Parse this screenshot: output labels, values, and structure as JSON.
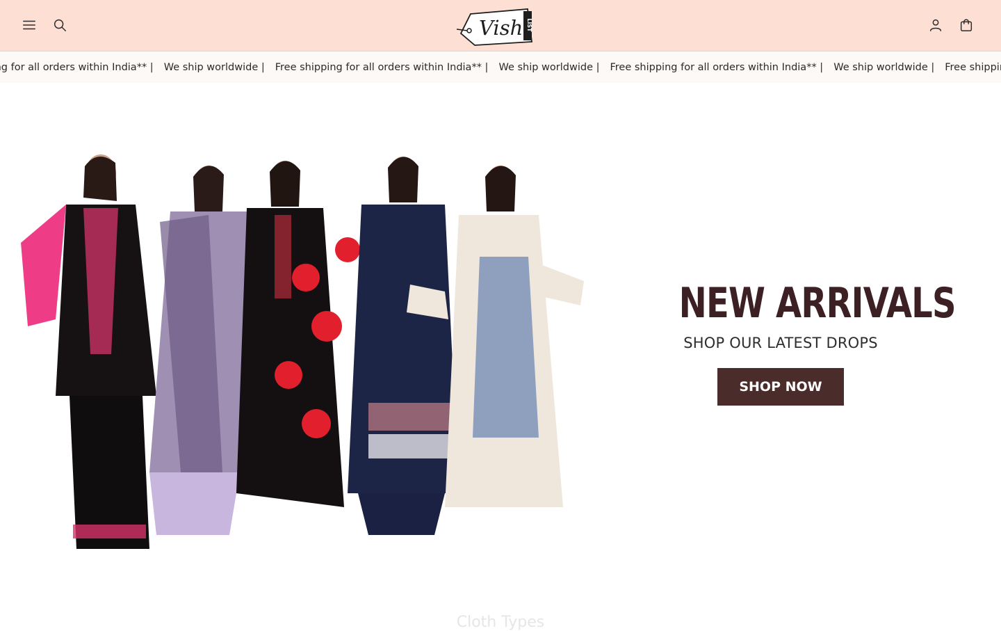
{
  "header": {
    "menu_icon": "hamburger-menu-icon",
    "search_icon": "search-icon",
    "account_icon": "user-account-icon",
    "cart_icon": "shopping-bag-icon",
    "logo_text": "Vish",
    "logo_tag": "LIST"
  },
  "announcement": {
    "items": [
      "Free shipping for all orders within India** |",
      "We ship worldwide |",
      "Free shipping for all orders within India** |",
      "We ship worldwide |",
      "Free shipping for all orders within India** |",
      "We ship worldwide |",
      "Free shipping for all orders within India** |"
    ]
  },
  "hero": {
    "title": "NEW ARRIVALS",
    "subtitle": "SHOP OUR LATEST DROPS",
    "cta_label": "SHOP NOW"
  },
  "next_section": {
    "title": "Cloth Types"
  },
  "colors": {
    "header_bg": "#fde0d3",
    "brand_dark": "#4a2c2b",
    "title_color": "#3d2023"
  }
}
